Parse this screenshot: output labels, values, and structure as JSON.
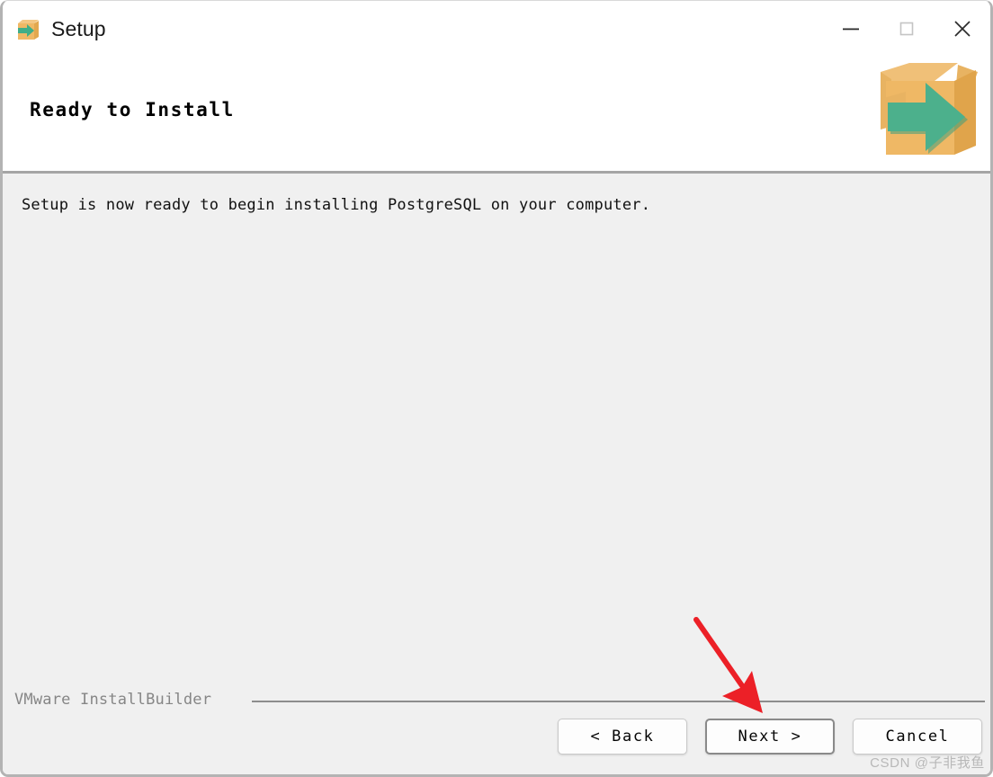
{
  "window": {
    "title": "Setup",
    "icon": "installer-box-icon",
    "controls": [
      {
        "name": "minimize",
        "glyph": "minimize-icon"
      },
      {
        "name": "maximize",
        "glyph": "maximize-icon"
      },
      {
        "name": "close",
        "glyph": "close-icon"
      }
    ]
  },
  "header": {
    "heading": "Ready to Install",
    "graphic": "install-box-arrow-icon"
  },
  "main": {
    "message": "Setup is now ready to begin installing PostgreSQL on your computer."
  },
  "footer": {
    "brand": "VMware InstallBuilder",
    "buttons": {
      "back": "< Back",
      "next": "Next >",
      "cancel": "Cancel"
    }
  },
  "annotation": {
    "arrow_color": "#EC2027",
    "arrow_from": "770,687",
    "arrow_to": "842,790"
  },
  "watermark": {
    "text": "CSDN @子非我鱼"
  },
  "colors": {
    "titlebar_bg": "#FFFFFF",
    "body_bg": "#F0F0F0",
    "divider": "#A5A5A5",
    "window_border": "#B3B3B3",
    "brand_text": "#868686",
    "box_orange": "#EFB865",
    "box_orange_dark": "#E2A84F",
    "arrow_green": "#4CB08C"
  }
}
